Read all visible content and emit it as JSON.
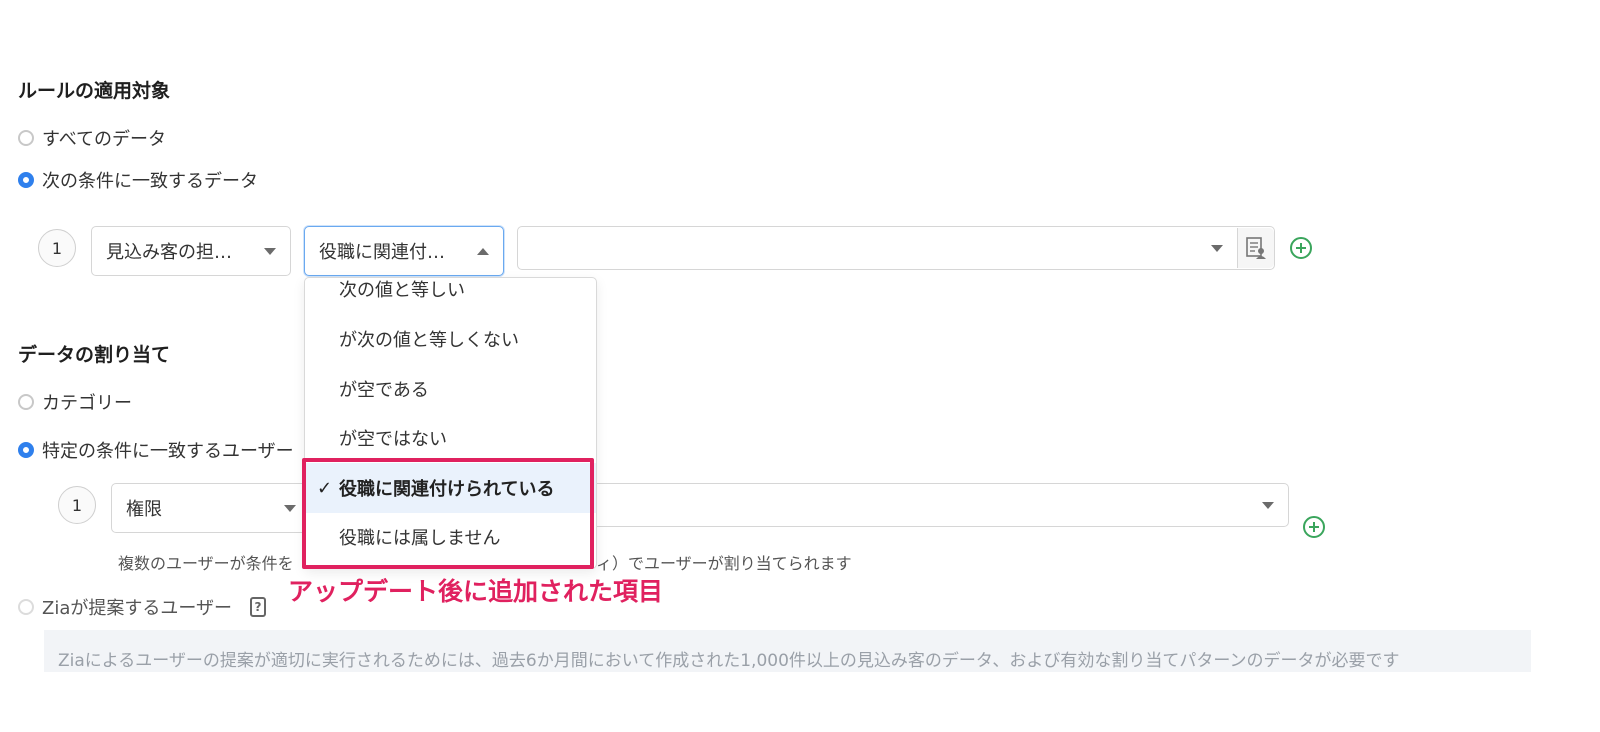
{
  "rule_target": {
    "title": "ルールの適用対象",
    "options": [
      {
        "label": "すべてのデータ",
        "checked": false
      },
      {
        "label": "次の条件に一致するデータ",
        "checked": true
      }
    ],
    "condition": {
      "index": "1",
      "field_value": "見込み客の担…",
      "operator_value": "役職に関連付…",
      "value_placeholder": ""
    }
  },
  "operator_dropdown": {
    "items": [
      {
        "label": "次の値と等しい",
        "selected": false
      },
      {
        "label": "が次の値と等しくない",
        "selected": false
      },
      {
        "label": "が空である",
        "selected": false
      },
      {
        "label": "が空ではない",
        "selected": false
      },
      {
        "label": "役職に関連付けられている",
        "selected": true
      },
      {
        "label": "役職には属しません",
        "selected": false
      }
    ],
    "check_mark": "✓"
  },
  "annotation": {
    "text": "アップデート後に追加された項目",
    "color": "#e0215f"
  },
  "assignment": {
    "title": "データの割り当て",
    "options": [
      {
        "label": "カテゴリー",
        "checked": false
      },
      {
        "label": "特定の条件に一致するユーザー",
        "checked": true
      }
    ],
    "condition": {
      "index": "1",
      "field_value": "権限"
    },
    "hint_left": "複数のユーザーが条件を",
    "hint_right": "ィ）でユーザーが割り当てられます",
    "zia_option": {
      "label": "Ziaが提案するユーザー",
      "checked": false,
      "help_icon": "help-icon"
    },
    "zia_info": "Ziaによるユーザーの提案が適切に実行されるためには、過去6か月間において作成された1,000件以上の見込み客のデータ、および有効な割り当てパターンのデータが必要です"
  },
  "colors": {
    "accent": "#2f80ed",
    "add_green": "#3aa55c",
    "annotation": "#e0215f"
  }
}
